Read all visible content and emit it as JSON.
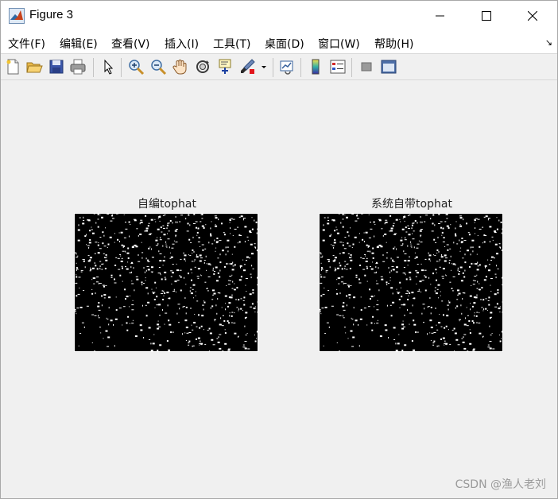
{
  "window": {
    "title": "Figure 3",
    "controls": {
      "minimize": "minimize-icon",
      "maximize": "maximize-icon",
      "close": "close-icon"
    }
  },
  "menu": [
    {
      "label": "文件(F)"
    },
    {
      "label": "编辑(E)"
    },
    {
      "label": "查看(V)"
    },
    {
      "label": "插入(I)"
    },
    {
      "label": "工具(T)"
    },
    {
      "label": "桌面(D)"
    },
    {
      "label": "窗口(W)"
    },
    {
      "label": "帮助(H)"
    }
  ],
  "toolbar": [
    {
      "icon": "new-figure-icon"
    },
    {
      "icon": "open-file-icon"
    },
    {
      "icon": "save-icon"
    },
    {
      "icon": "print-icon"
    },
    {
      "icon": "pointer-icon"
    },
    {
      "icon": "zoom-in-icon"
    },
    {
      "icon": "zoom-out-icon"
    },
    {
      "icon": "pan-hand-icon"
    },
    {
      "icon": "rotate-3d-icon"
    },
    {
      "icon": "data-cursor-icon"
    },
    {
      "icon": "brush-icon"
    },
    {
      "icon": "link-plot-icon"
    },
    {
      "icon": "colorbar-icon"
    },
    {
      "icon": "legend-icon"
    },
    {
      "icon": "hide-plot-tools-icon"
    },
    {
      "icon": "show-plot-tools-icon"
    }
  ],
  "axes": [
    {
      "title": "自编tophat"
    },
    {
      "title": "系统自带tophat"
    }
  ],
  "watermark": "CSDN @渔人老刘"
}
